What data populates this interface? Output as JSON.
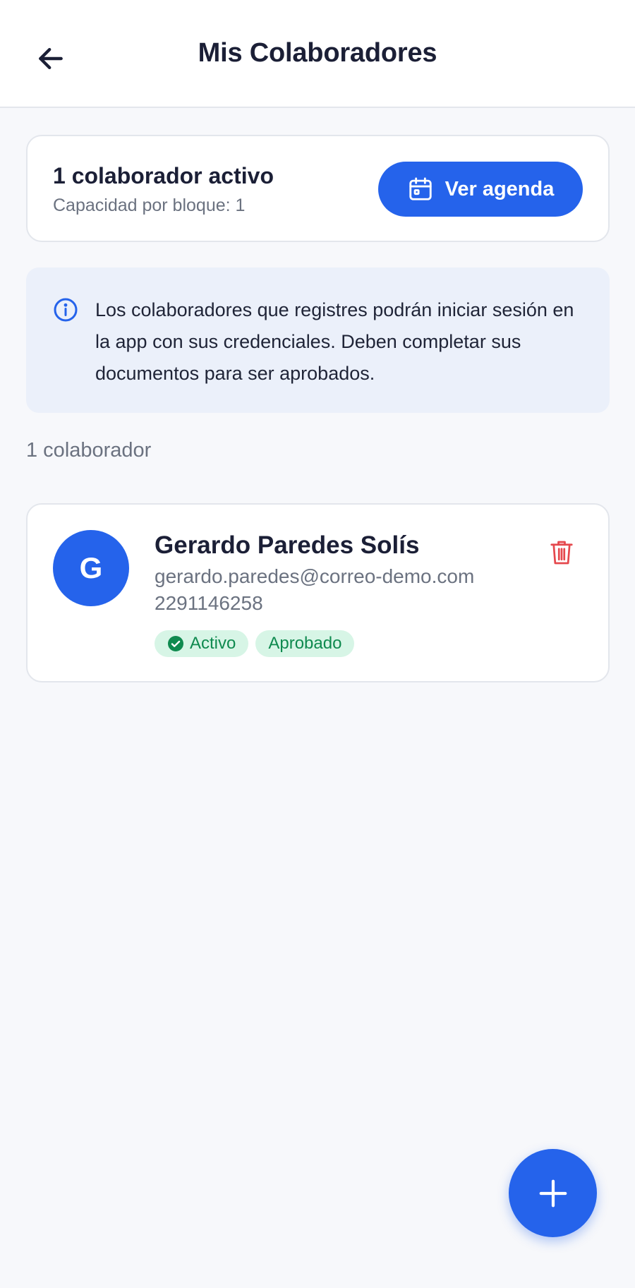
{
  "header": {
    "title": "Mis Colaboradores",
    "back_icon": "arrow-left-icon"
  },
  "summary": {
    "title": "1 colaborador activo",
    "subtitle": "Capacidad por bloque: 1",
    "agenda_button": "Ver agenda",
    "agenda_icon": "calendar-icon"
  },
  "info": {
    "icon": "info-icon",
    "text": "Los colaboradores que registres podrán iniciar sesión en la app con sus credenciales. Deben completar sus documentos para ser aprobados."
  },
  "list": {
    "count_label": "1 colaborador",
    "items": [
      {
        "initial": "G",
        "name": "Gerardo Paredes Solís",
        "email": "gerardo.paredes@correo-demo.com",
        "phone": "2291146258",
        "badges": [
          "Activo",
          "Aprobado"
        ]
      }
    ]
  },
  "fab": {
    "icon": "plus-icon"
  },
  "colors": {
    "primary": "#2563eb",
    "success_bg": "#d7f5e6",
    "success_text": "#0f8a4f",
    "danger": "#e5484d",
    "info_bg": "#ebf0fa"
  }
}
